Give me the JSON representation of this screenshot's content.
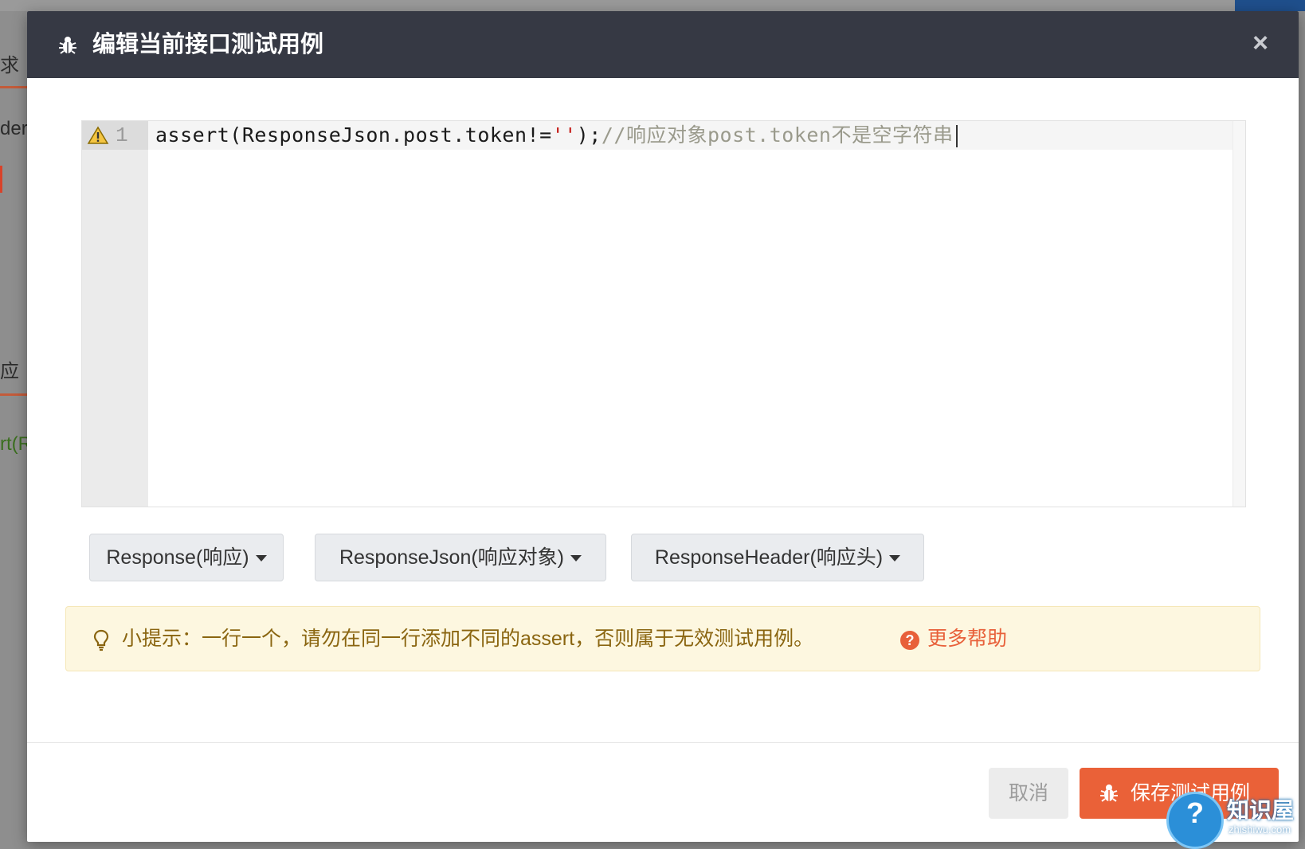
{
  "background": {
    "fragments": [
      "求",
      "der",
      "应",
      "rt(R"
    ]
  },
  "modal": {
    "title": "编辑当前接口测试用例",
    "close_symbol": "×",
    "header_icon": "bug-icon"
  },
  "editor": {
    "line_number": "1",
    "gutter_icon": "warning-icon",
    "code": {
      "prefix": "assert(ResponseJson.post.token!=",
      "string": "''",
      "suffix": ");",
      "comment": "//响应对象post.token不是空字符串"
    }
  },
  "dropdowns": [
    {
      "label": "Response(响应)"
    },
    {
      "label": "ResponseJson(响应对象)"
    },
    {
      "label": "ResponseHeader(响应头)"
    }
  ],
  "tip": {
    "icon": "lightbulb-icon",
    "text": "小提示：一行一个，请勿在同一行添加不同的assert，否则属于无效测试用例。",
    "help_icon_symbol": "?",
    "help_link": "更多帮助"
  },
  "footer": {
    "cancel_label": "取消",
    "save_label": "保存测试用例",
    "save_icon": "bug-icon"
  },
  "watermark": {
    "symbol": "?",
    "text": "知识屋",
    "sub": "zhishiwu.com"
  },
  "colors": {
    "header_bg": "#363944",
    "accent": "#ea6138",
    "tip_bg": "#fdf7e0",
    "tip_text": "#8a6510"
  }
}
